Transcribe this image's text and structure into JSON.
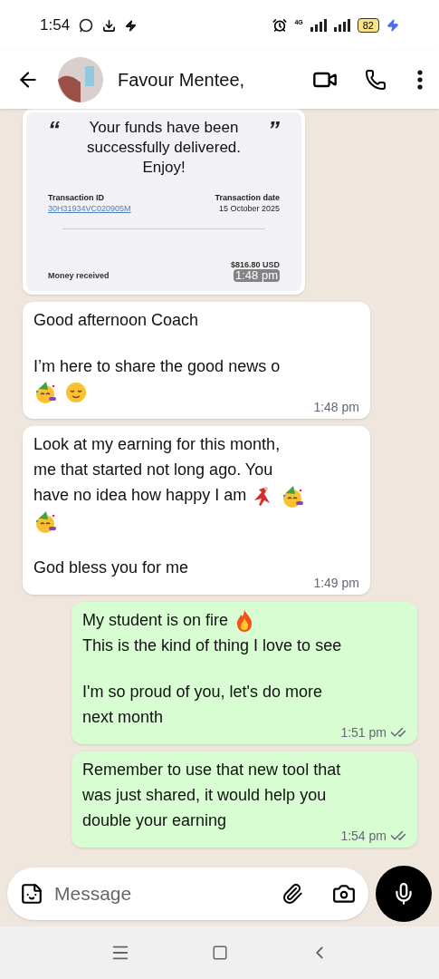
{
  "status_bar": {
    "time": "1:54",
    "network": "4G",
    "battery": "82"
  },
  "header": {
    "contact_name": "Favour Mentee,"
  },
  "messages": [
    {
      "kind": "incoming-receipt",
      "quote": "Your funds have been successfully delivered. Enjoy!",
      "open_quote": "“",
      "close_quote": "”",
      "id_label": "Transaction ID",
      "id_value": "30H31934VC020905M",
      "date_label": "Transaction date",
      "date_value": "15 October 2025",
      "amount_label": "Money received",
      "amount_value": "$816.80 USD",
      "time": "1:48 pm"
    },
    {
      "kind": "incoming-text",
      "time": "1:48 pm",
      "paragraphs": [
        [
          [
            {
              "kind": "text",
              "text": "Good afternoon Coach"
            }
          ]
        ],
        [
          [
            {
              "kind": "text",
              "text": "I’m here to share the good news o"
            }
          ],
          [
            {
              "kind": "party-face"
            },
            {
              "kind": "relieved-face"
            }
          ]
        ]
      ]
    },
    {
      "kind": "incoming-text",
      "time": "1:49 pm",
      "paragraphs": [
        [
          [
            {
              "kind": "text",
              "text": "Look at my earning for this month,"
            }
          ],
          [
            {
              "kind": "text",
              "text": "me that started not long ago. You"
            }
          ],
          [
            {
              "kind": "text",
              "text": "have no idea how happy I am"
            },
            {
              "kind": "dancer"
            },
            {
              "kind": "party-face"
            }
          ],
          [
            {
              "kind": "party-face"
            }
          ]
        ],
        [
          [
            {
              "kind": "text",
              "text": "God bless you for me"
            }
          ]
        ]
      ]
    },
    {
      "kind": "outgoing-text",
      "time": "1:51 pm",
      "read": true,
      "paragraphs": [
        [
          [
            {
              "kind": "text",
              "text": "My student is on fire"
            },
            {
              "kind": "fire"
            }
          ],
          [
            {
              "kind": "text",
              "text": "This is the kind of thing I love to see"
            }
          ]
        ],
        [
          [
            {
              "kind": "text",
              "text": "I'm so proud of you, let's do more"
            }
          ],
          [
            {
              "kind": "text",
              "text": "next month"
            }
          ]
        ]
      ]
    },
    {
      "kind": "outgoing-text",
      "time": "1:54 pm",
      "read": true,
      "paragraphs": [
        [
          [
            {
              "kind": "text",
              "text": "Remember to use that new tool that"
            }
          ],
          [
            {
              "kind": "text",
              "text": "was just shared, it would help you"
            }
          ],
          [
            {
              "kind": "text",
              "text": "double your earning"
            }
          ]
        ]
      ]
    }
  ],
  "composer": {
    "placeholder": "Message"
  }
}
